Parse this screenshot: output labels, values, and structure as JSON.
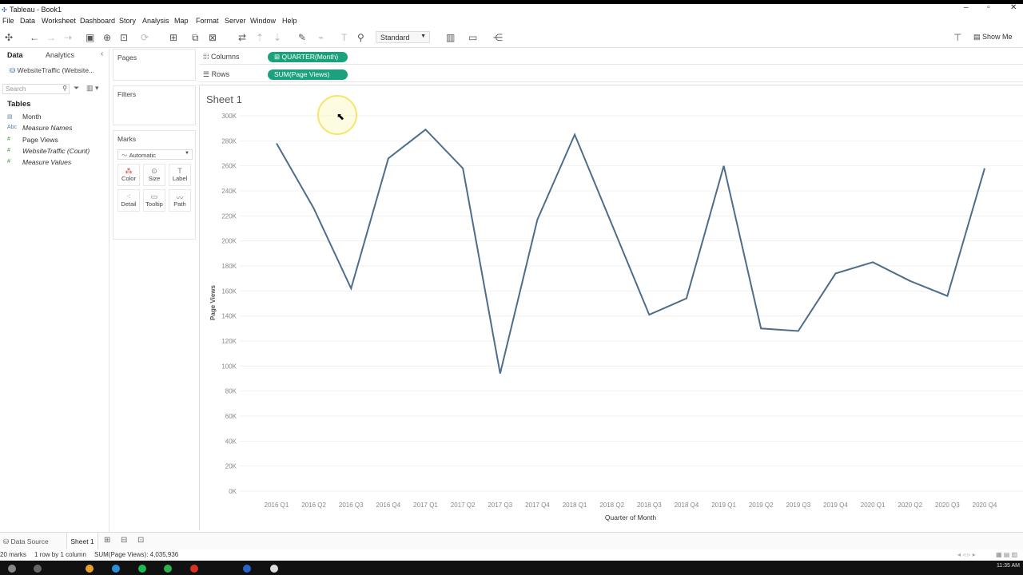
{
  "window": {
    "title": "Tableau - Book1"
  },
  "menu": [
    "File",
    "Data",
    "Worksheet",
    "Dashboard",
    "Story",
    "Analysis",
    "Map",
    "Format",
    "Server",
    "Window",
    "Help"
  ],
  "toolbar": {
    "fit_select": "Standard",
    "show_me": "Show Me"
  },
  "left_pane": {
    "tabs": {
      "data": "Data",
      "analytics": "Analytics"
    },
    "datasource": "WebsiteTraffic (Website...",
    "search_placeholder": "Search",
    "tables_header": "Tables",
    "fields": [
      {
        "label": "Month",
        "icon": "calendar-icon",
        "kind": "dimension",
        "italic": false
      },
      {
        "label": "Measure Names",
        "icon": "Abc",
        "kind": "dimension",
        "italic": true
      },
      {
        "label": "Page Views",
        "icon": "#",
        "kind": "measure",
        "italic": false
      },
      {
        "label": "WebsiteTraffic (Count)",
        "icon": "#",
        "kind": "measure",
        "italic": true
      },
      {
        "label": "Measure Values",
        "icon": "#",
        "kind": "measure",
        "italic": true
      }
    ]
  },
  "cards": {
    "pages": "Pages",
    "filters": "Filters",
    "marks": "Marks",
    "marks_type": "Automatic",
    "mark_buttons": [
      "Color",
      "Size",
      "Label",
      "Detail",
      "Tooltip",
      "Path"
    ]
  },
  "shelves": {
    "columns_label": "Columns",
    "columns_pill": "QUARTER(Month)",
    "rows_label": "Rows",
    "rows_pill": "SUM(Page Views)"
  },
  "sheet": {
    "title": "Sheet 1"
  },
  "chart_data": {
    "type": "line",
    "title": "Sheet 1",
    "xlabel": "Quarter of Month",
    "ylabel": "Page Views",
    "categories": [
      "2016 Q1",
      "2016 Q2",
      "2016 Q3",
      "2016 Q4",
      "2017 Q1",
      "2017 Q2",
      "2017 Q3",
      "2017 Q4",
      "2018 Q1",
      "2018 Q2",
      "2018 Q3",
      "2018 Q4",
      "2019 Q1",
      "2019 Q2",
      "2019 Q3",
      "2019 Q4",
      "2020 Q1",
      "2020 Q2",
      "2020 Q3",
      "2020 Q4"
    ],
    "series": [
      {
        "values": [
          278000,
          226000,
          162000,
          266000,
          289000,
          258000,
          94000,
          217000,
          285000,
          213000,
          141000,
          154000,
          260000,
          130000,
          128000,
          174000,
          183000,
          168000,
          156000,
          258000
        ]
      }
    ],
    "yticks": [
      "0K",
      "20K",
      "40K",
      "60K",
      "80K",
      "100K",
      "120K",
      "140K",
      "160K",
      "180K",
      "200K",
      "220K",
      "240K",
      "260K",
      "280K",
      "300K"
    ],
    "ylim": [
      0,
      300000
    ],
    "grid": true,
    "line_color": "#4e6d8a"
  },
  "bottom_tabs": {
    "datasource": "Data Source",
    "sheet": "Sheet 1"
  },
  "status": {
    "marks": "20 marks",
    "dims": "1 row by 1 column",
    "sum": "SUM(Page Views): 4,035,936"
  },
  "taskbar": {
    "clock": "11:35 AM"
  }
}
